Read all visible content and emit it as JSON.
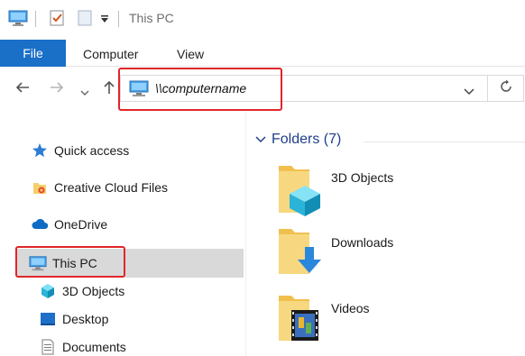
{
  "window": {
    "title": "This PC"
  },
  "ribbon": {
    "tabs": [
      {
        "label": "File"
      },
      {
        "label": "Computer"
      },
      {
        "label": "View"
      }
    ]
  },
  "address": {
    "value": "\\\\computername"
  },
  "navigation": {
    "items": [
      {
        "label": "Quick access",
        "icon": "star-icon"
      },
      {
        "label": "Creative Cloud Files",
        "icon": "creative-cloud-icon"
      },
      {
        "label": "OneDrive",
        "icon": "cloud-icon"
      },
      {
        "label": "This PC",
        "icon": "computer-icon"
      },
      {
        "label": "3D Objects",
        "icon": "cube-icon"
      },
      {
        "label": "Desktop",
        "icon": "desktop-icon"
      },
      {
        "label": "Documents",
        "icon": "document-icon"
      }
    ]
  },
  "content": {
    "group": {
      "label": "Folders (7)"
    },
    "folders": [
      {
        "label": "3D Objects"
      },
      {
        "label": "Downloads"
      },
      {
        "label": "Videos"
      }
    ]
  },
  "colors": {
    "accent": "#1a6fc7",
    "highlight": "#e0262a",
    "folder": "#f5cf6b",
    "group_header": "#1e3f8a"
  }
}
